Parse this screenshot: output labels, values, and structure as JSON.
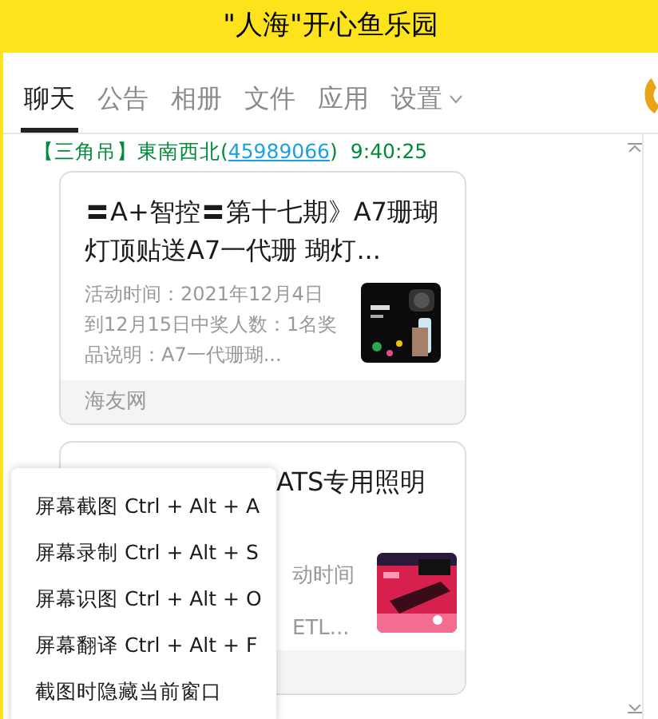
{
  "window": {
    "title": "\"人海\"开心鱼乐园"
  },
  "tabs": [
    {
      "label": "聊天",
      "selected": true,
      "dropdown": false
    },
    {
      "label": "公告",
      "selected": false,
      "dropdown": false
    },
    {
      "label": "相册",
      "selected": false,
      "dropdown": false
    },
    {
      "label": "文件",
      "selected": false,
      "dropdown": false
    },
    {
      "label": "应用",
      "selected": false,
      "dropdown": false
    },
    {
      "label": "设置",
      "selected": false,
      "dropdown": true
    }
  ],
  "message": {
    "role": "【三角吊】",
    "sender": "東南西北(",
    "sender_id": "45989066",
    "sender_close": ")",
    "time": "9:40:25"
  },
  "cards": [
    {
      "title": "〓A+智控〓第十七期》A7珊瑚灯顶贴送A7一代珊 瑚灯...",
      "description": "活动时间：2021年12月4日到12月15日中奖人数：1名奖品说明：A7一代珊瑚...",
      "source": "海友网"
    },
    {
      "title": "ATS专用照明",
      "description_lines": [
        "动时间",
        "ETL..."
      ]
    }
  ],
  "context_menu": [
    {
      "label": "屏幕截图 Ctrl + Alt + A"
    },
    {
      "label": "屏幕录制 Ctrl + Alt + S"
    },
    {
      "label": "屏幕识图 Ctrl + Alt + O"
    },
    {
      "label": "屏幕翻译 Ctrl + Alt + F"
    },
    {
      "label": "截图时隐藏当前窗口"
    }
  ]
}
